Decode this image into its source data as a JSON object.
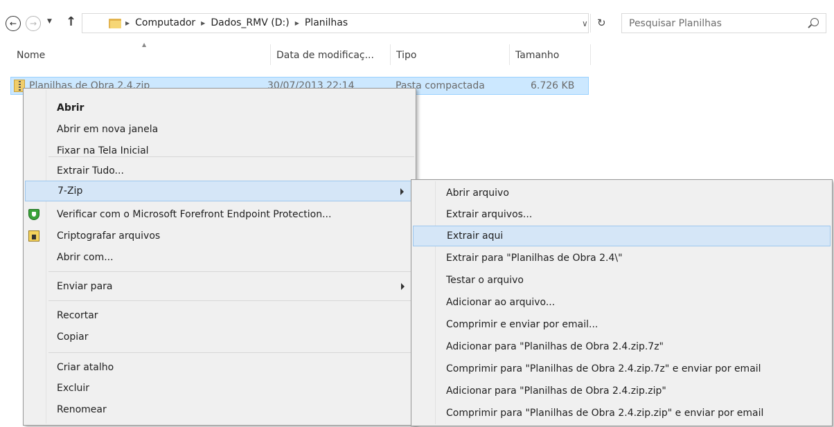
{
  "search": {
    "placeholder": "Pesquisar Planilhas"
  },
  "breadcrumb": [
    "Computador",
    "Dados_RMV (D:)",
    "Planilhas"
  ],
  "columns": {
    "name": "Nome",
    "date": "Data de modificaç...",
    "type": "Tipo",
    "size": "Tamanho"
  },
  "file": {
    "name": "Planilhas de Obra 2.4.zip",
    "date": "30/07/2013 22:14",
    "type": "Pasta compactada",
    "size": "6.726 KB"
  },
  "context_menu": {
    "items": [
      "Abrir",
      "Abrir em nova janela",
      "Fixar na Tela Inicial",
      "Extrair Tudo...",
      "7-Zip",
      "Verificar com o Microsoft Forefront Endpoint Protection...",
      "Criptografar arquivos",
      "Abrir com...",
      "Enviar para",
      "Recortar",
      "Copiar",
      "Criar atalho",
      "Excluir",
      "Renomear"
    ]
  },
  "submenu_7zip": {
    "items": [
      "Abrir arquivo",
      "Extrair arquivos...",
      "Extrair aqui",
      "Extrair para \"Planilhas de Obra 2.4\\\"",
      "Testar o arquivo",
      "Adicionar ao arquivo...",
      "Comprimir e enviar por email...",
      "Adicionar para \"Planilhas de Obra 2.4.zip.7z\"",
      "Comprimir para \"Planilhas de Obra 2.4.zip.7z\" e enviar por email",
      "Adicionar para \"Planilhas de Obra 2.4.zip.zip\"",
      "Comprimir para \"Planilhas de Obra 2.4.zip.zip\" e enviar por email"
    ]
  },
  "colors": {
    "selection": "#cce8ff",
    "menu_highlight": "#d5e6f7",
    "menu_bg": "#f0f0f0"
  }
}
